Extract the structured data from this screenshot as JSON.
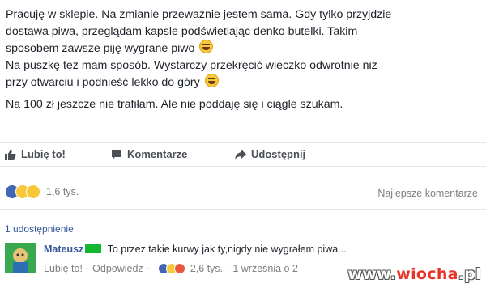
{
  "post": {
    "line1": "Pracuję w sklepie. Na zmianie przeważnie jestem sama. Gdy tylko przyjdzie",
    "line2": "dostawa piwa, przeglądam kapsle podświetlając denko butelki. Takim",
    "line3": "sposobem zawsze piję wygrane piwo",
    "line4": "Na puszkę też mam sposób. Wystarczy przekręcić wieczko odwrotnie niż",
    "line5": "przy otwarciu i podnieść lekko do góry",
    "line6": "Na 100 zł jeszcze nie trafiłam. Ale nie poddaję się i ciągle szukam."
  },
  "actions": {
    "like": "Lubię to!",
    "comment": "Komentarze",
    "share": "Udostępnij"
  },
  "reactions": {
    "count": "1,6 tys."
  },
  "best_comments": "Najlepsze komentarze",
  "shares": "1 udostępnienie",
  "comment": {
    "author": "Mateusz",
    "text": "To przez takie kurwy jak ty,nigdy nie wygrałem piwa...",
    "like": "Lubię to!",
    "reply": "Odpowiedz",
    "sep": "·",
    "reactions_count": "2,6 tys.",
    "date": "1 września o 2"
  },
  "watermark": {
    "prefix": "www.",
    "brand": "wiocha",
    "suffix": ".pl"
  },
  "colors": {
    "link": "#365899",
    "meta": "#7f7f7f",
    "like_blue": "#4267b2",
    "flag_green": "#12b833"
  }
}
